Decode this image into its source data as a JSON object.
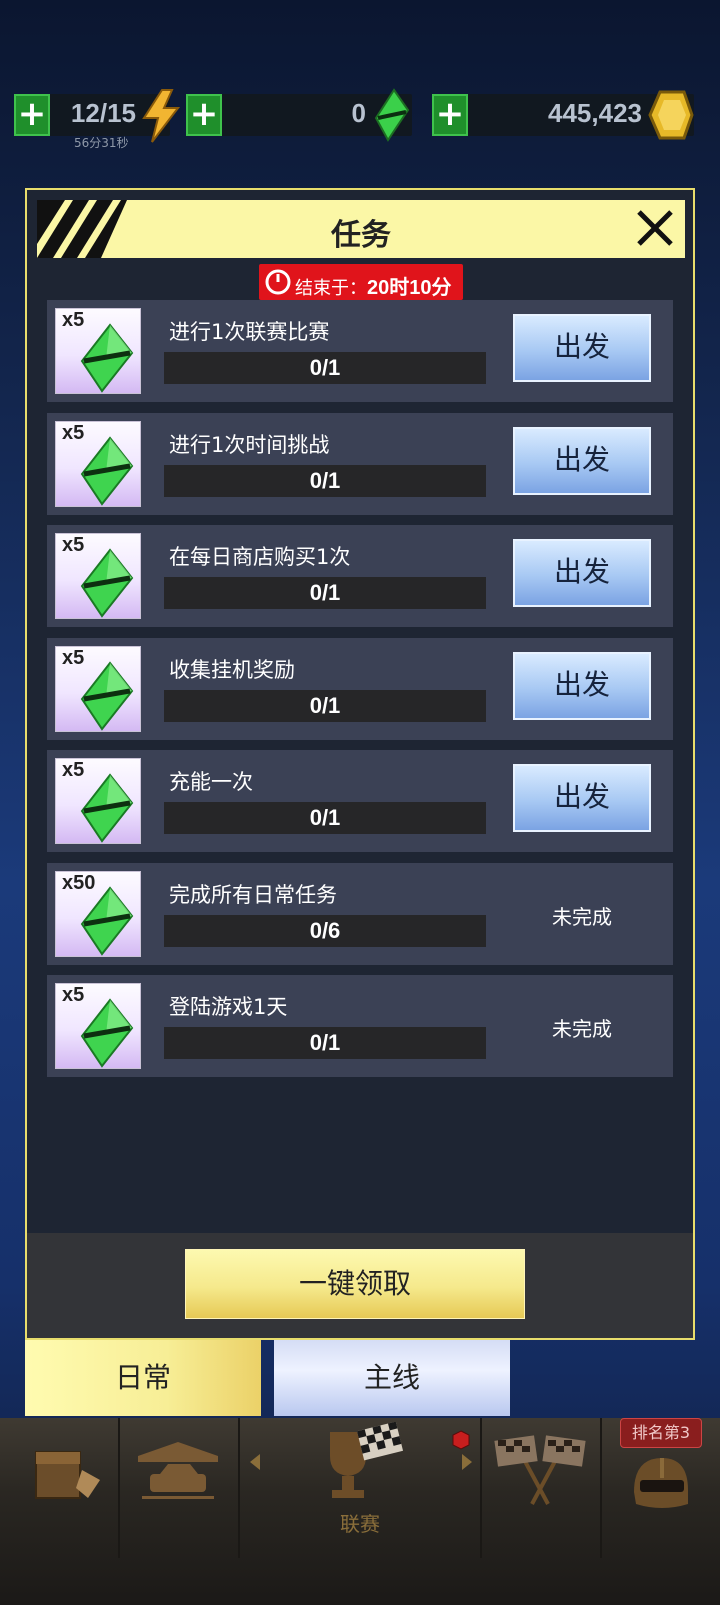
{
  "resources": {
    "energy": {
      "value": "12/15",
      "timer": "56分31秒",
      "icon": "lightning-icon"
    },
    "gems": {
      "value": "0",
      "icon": "green-gem-icon"
    },
    "coins": {
      "value": "445,423",
      "icon": "gold-coin-icon"
    }
  },
  "dialog": {
    "title": "任务",
    "timer_prefix": "结束于：",
    "timer_value": "20时10分",
    "claim_all_label": "一键领取",
    "tasks": [
      {
        "reward_qty": "x5",
        "title": "进行1次联赛比赛",
        "progress": "0/1",
        "fraction": 0,
        "action": "出发",
        "state": "button"
      },
      {
        "reward_qty": "x5",
        "title": "进行1次时间挑战",
        "progress": "0/1",
        "fraction": 0,
        "action": "出发",
        "state": "button"
      },
      {
        "reward_qty": "x5",
        "title": "在每日商店购买1次",
        "progress": "0/1",
        "fraction": 0,
        "action": "出发",
        "state": "button"
      },
      {
        "reward_qty": "x5",
        "title": "收集挂机奖励",
        "progress": "0/1",
        "fraction": 0,
        "action": "出发",
        "state": "button"
      },
      {
        "reward_qty": "x5",
        "title": "充能一次",
        "progress": "0/1",
        "fraction": 0,
        "action": "出发",
        "state": "button"
      },
      {
        "reward_qty": "x50",
        "title": "完成所有日常任务",
        "progress": "0/6",
        "fraction": 0,
        "action": "未完成",
        "state": "text"
      },
      {
        "reward_qty": "x5",
        "title": "登陆游戏1天",
        "progress": "0/1",
        "fraction": 0,
        "action": "未完成",
        "state": "text"
      }
    ]
  },
  "tabs": {
    "daily": "日常",
    "main": "主线"
  },
  "bottom_nav": {
    "items": [
      "storage-box-icon",
      "garage-car-icon",
      "league-trophy-icon",
      "race-flags-icon",
      "helmet-icon"
    ],
    "active_label": "联赛",
    "rank_badge": "排名第3"
  },
  "colors": {
    "accent_yellow": "#fbf7a6",
    "button_blue": "#a7c8f3",
    "timer_red": "#e0141b",
    "task_bg": "#3b4155"
  }
}
